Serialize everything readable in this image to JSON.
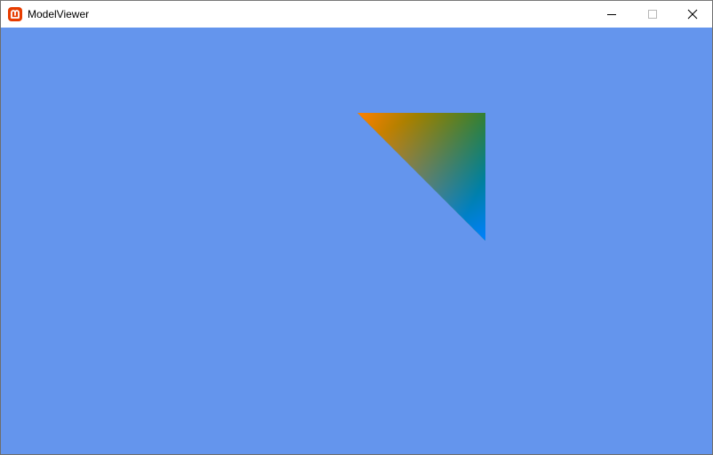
{
  "window": {
    "title": "ModelViewer",
    "app_icon": "monogame-logo-icon",
    "brand_color": "#E73C00",
    "caption_buttons": {
      "minimize": "minimize-icon",
      "maximize": "maximize-icon",
      "close": "close-icon"
    }
  },
  "scene": {
    "clear_color": "#6495ED",
    "triangle": {
      "vertex_colors": [
        "#FF0000",
        "#008000",
        "#0000FF"
      ]
    }
  }
}
